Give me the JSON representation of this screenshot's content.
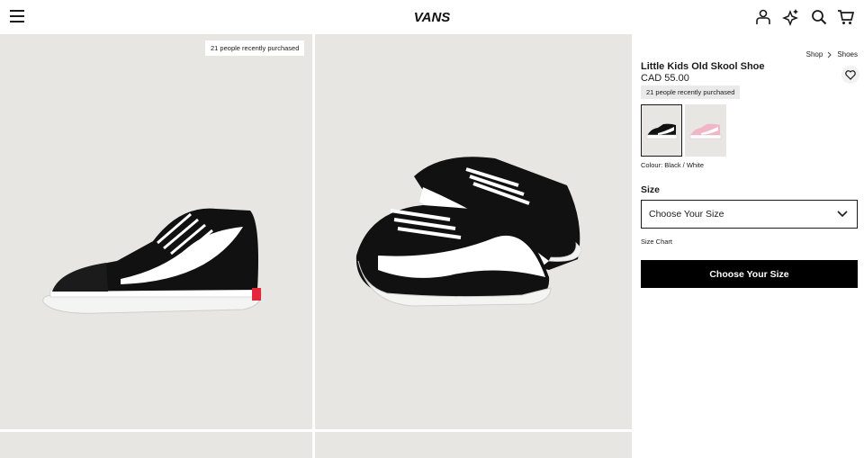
{
  "header": {
    "logo_text": "VANS",
    "icons": [
      "menu-icon",
      "account-icon",
      "sparkle-icon",
      "search-icon",
      "cart-icon"
    ]
  },
  "gallery": {
    "badge_text": "21 people recently purchased"
  },
  "breadcrumb": {
    "items": [
      "Shop",
      "Shoes"
    ]
  },
  "product": {
    "title": "Little Kids Old Skool Shoe",
    "price": "CAD 55.00",
    "purchased_badge": "21 people recently purchased",
    "colour_text": "Colour: Black / White",
    "swatches": [
      {
        "color": "#111111",
        "selected": true
      },
      {
        "color": "#f0b6c8",
        "selected": false
      }
    ]
  },
  "size": {
    "label": "Size",
    "select_value": "Choose Your Size",
    "chart_link": "Size Chart"
  },
  "cta": {
    "label": "Choose Your Size"
  },
  "colors": {
    "accent": "#000000",
    "tile_bg": "#e7e6e2"
  }
}
